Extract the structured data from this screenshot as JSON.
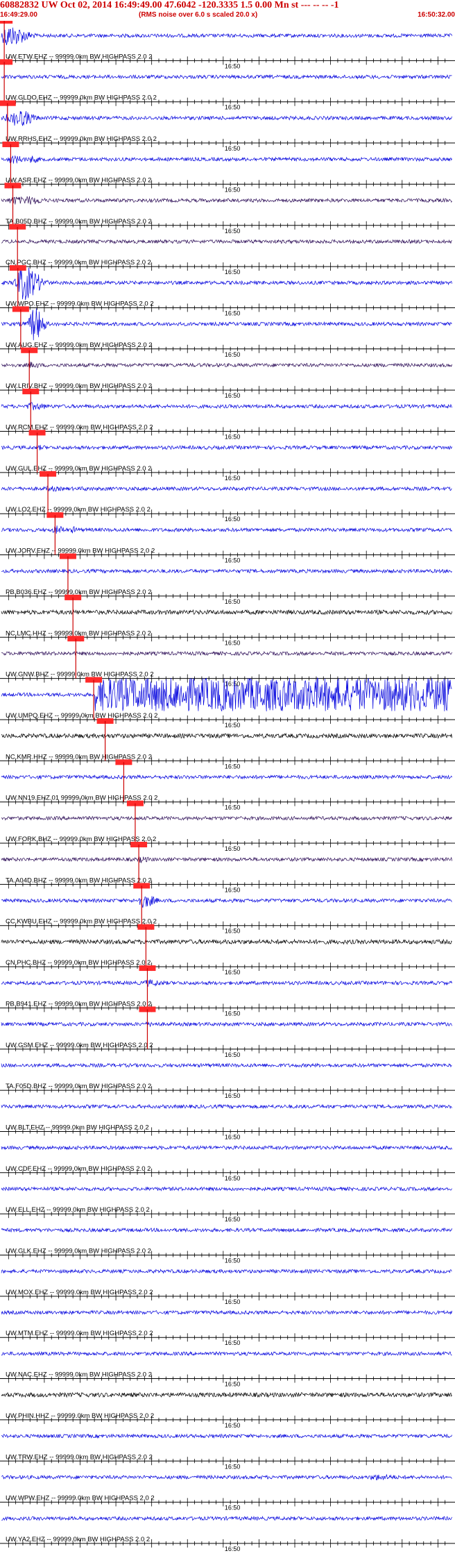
{
  "header": {
    "title": "60882832 UW Oct 02, 2014 16:49:49.00   47.6042 -120.3335  1.5 0.00 Mn st --- -- --  -1",
    "start_time": "16:49:29.00",
    "note": "(RMS noise over 6.0 s scaled 20.0 x)",
    "end_time": "16:50:32.00"
  },
  "colors": {
    "accent": "#cc0000",
    "trace_blue": "#0000dd",
    "trace_black": "#000000",
    "trace_purple": "#2a0a55",
    "pick_box": "#ff2a2a"
  },
  "chart_data": {
    "type": "line",
    "title": "60882832 UW Oct 02, 2014 16:49:49.00   47.6042 -120.3335  1.5 0.00 Mn st --- -- --  -1",
    "x_range": [
      "16:49:29.00",
      "16:50:32.00"
    ],
    "tick_label": "16:50",
    "grid": false,
    "traces": [
      {
        "label": "UW.ETW.EHZ -- 99999.0km BW  HIGHPASS  2.0  2",
        "color": "blue",
        "pick": 0.4,
        "events": [
          [
            1.0,
            3.0,
            6
          ],
          [
            0.72,
            0.3,
            8
          ],
          [
            1.12,
            0.4,
            7
          ]
        ]
      },
      {
        "label": "UW.GLDO.EHZ -- 99999.0km BW  HIGHPASS  2.0  2",
        "color": "blue",
        "pick": 0.4,
        "events": []
      },
      {
        "label": "UW.RRHS.EHZ -- 99999.0km BW  HIGHPASS  2.0  2",
        "color": "blue",
        "pick": 0.85,
        "events": [
          [
            1.0,
            2.0,
            2.5
          ],
          [
            2.25,
            2.5,
            5
          ],
          [
            3.3,
            2.0,
            3
          ]
        ]
      },
      {
        "label": "UW.ASR.EHZ -- 99999.0km BW  HIGHPASS  2.0  2",
        "color": "blue",
        "pick": 1.3,
        "events": [
          [
            1.5,
            2.2,
            2.5
          ],
          [
            4.2,
            1.5,
            2.2
          ]
        ]
      },
      {
        "label": "TA.B05D.BHZ -- 99999.0km BW  HIGHPASS  2.0  2",
        "color": "purple",
        "pick": 1.6,
        "events": [
          [
            1.7,
            2.0,
            2.5
          ],
          [
            3.7,
            2.8,
            2.5
          ]
        ]
      },
      {
        "label": "CN.PGC.BHZ -- 99999.0km BW  HIGHPASS  2.0  2",
        "color": "purple",
        "pick": 2.25,
        "events": []
      },
      {
        "label": "UW.WPO.EHZ -- 99999.0km BW  HIGHPASS  2.0  2",
        "color": "blue",
        "pick": 2.3,
        "events": [
          [
            2.5,
            2.5,
            1.8
          ],
          [
            3.0,
            2.5,
            10
          ]
        ]
      },
      {
        "label": "UW.AUG.EHZ -- 99999.0km BW  HIGHPASS  2.0  2",
        "color": "blue",
        "pick": 2.7,
        "events": [
          [
            2.8,
            1.5,
            1.5
          ],
          [
            4.5,
            1.5,
            10
          ]
        ]
      },
      {
        "label": "UW.LRIV.BHZ -- 99999.0km BW  HIGHPASS  2.0  2",
        "color": "purple",
        "pick": 3.9,
        "events": [
          [
            4.1,
            1.8,
            2
          ]
        ]
      },
      {
        "label": "UW.RCM.EHZ -- 99999.0km BW  HIGHPASS  2.0  2",
        "color": "blue",
        "pick": 4.1,
        "events": [
          [
            4.3,
            2.8,
            2.2
          ]
        ]
      },
      {
        "label": "UW.GUL.EHZ -- 99999.0km BW  HIGHPASS  2.0  2",
        "color": "blue",
        "pick": 5.0,
        "events": [
          [
            5.3,
            1.4,
            1.5
          ]
        ]
      },
      {
        "label": "UW.LO2.EHZ -- 99999.0km BW  HIGHPASS  2.0  2",
        "color": "blue",
        "pick": 6.5,
        "events": [
          [
            6.7,
            2.6,
            1.6
          ],
          [
            11.5,
            2.0,
            1.3
          ]
        ]
      },
      {
        "label": "UW.JORV.EHZ -- 99999.0km BW  HIGHPASS  2.0  2",
        "color": "blue",
        "pick": 7.5,
        "events": [
          [
            7.7,
            1.6,
            2.5
          ],
          [
            10.0,
            1.0,
            2.0
          ]
        ]
      },
      {
        "label": "PB.B036.EHZ -- 99999.0km BW  HIGHPASS  2.0  2",
        "color": "blue",
        "pick": 9.3,
        "events": []
      },
      {
        "label": "NC.LMC.HHZ -- 99999.0km BW  HIGHPASS  2.0  2",
        "color": "black",
        "pick": 10.0,
        "events": []
      },
      {
        "label": "UW.GNW.BHZ -- 99999.0km BW  HIGHPASS  2.0  2",
        "color": "purple",
        "pick": 10.4,
        "events": [
          [
            10.6,
            1.0,
            0.8
          ]
        ]
      },
      {
        "label": "UW.UMPQ.EHZ -- 99999.0km BW  HIGHPASS  2.0  2",
        "color": "blue",
        "pick": 12.9,
        "events": [
          [
            13.1,
            1.0,
            99
          ]
        ]
      },
      {
        "label": "NC.KMR.HHZ -- 99999.0km BW  HIGHPASS  2.0  2",
        "color": "black",
        "pick": 14.5,
        "events": []
      },
      {
        "label": "UW.NN19.EHZ.01 99999.0km BW  HIGHPASS  2.0  2",
        "color": "blue",
        "pick": 17.1,
        "events": []
      },
      {
        "label": "UW.FORK.BHZ -- 99999.0km BW  HIGHPASS  2.0  2",
        "color": "purple",
        "pick": 18.7,
        "events": []
      },
      {
        "label": "TA.A04D.BHZ -- 99999.0km BW  HIGHPASS  2.0  2",
        "color": "purple",
        "pick": 19.2,
        "events": [
          [
            19.5,
            1.5,
            2.0
          ]
        ]
      },
      {
        "label": "CC.KWBU.EHZ -- 99999.0km BW  HIGHPASS  2.0  2",
        "color": "blue",
        "pick": 19.6,
        "events": [
          [
            19.8,
            2.0,
            4.0
          ]
        ]
      },
      {
        "label": "CN.PHC.BHZ -- 99999.0km BW  HIGHPASS  2.0  2",
        "color": "black",
        "pick": 20.2,
        "events": []
      },
      {
        "label": "PB.B941.EHZ -- 99999.0km BW  HIGHPASS  2.0  2",
        "color": "blue",
        "pick": 20.4,
        "events": [
          [
            20.6,
            2.8,
            2.0
          ]
        ]
      },
      {
        "label": "UW.GSM.EHZ -- 99999.0km BW  HIGHPASS  2.0  2",
        "color": "blue",
        "pick": 20.4,
        "events": [
          [
            20.6,
            2.5,
            1.5
          ]
        ]
      },
      {
        "label": "TA.F05D.BHZ -- 99999.0km BW  HIGHPASS  2.0  2",
        "color": "blue",
        "pick": null,
        "events": []
      },
      {
        "label": "UW.BLT.EHZ -- 99999.0km BW  HIGHPASS  2.0  2",
        "color": "blue",
        "pick": null,
        "events": []
      },
      {
        "label": "UW.CDF.EHZ -- 99999.0km BW  HIGHPASS  2.0  2",
        "color": "blue",
        "pick": null,
        "events": []
      },
      {
        "label": "UW.ELL.EHZ -- 99999.0km BW  HIGHPASS  2.0  2",
        "color": "blue",
        "pick": null,
        "events": []
      },
      {
        "label": "UW.GLK.EHZ -- 99999.0km BW  HIGHPASS  2.0  2",
        "color": "blue",
        "pick": null,
        "events": []
      },
      {
        "label": "UW.MOX.EHZ -- 99999.0km BW  HIGHPASS  2.0  2",
        "color": "blue",
        "pick": null,
        "events": []
      },
      {
        "label": "UW.MTM.EHZ -- 99999.0km BW  HIGHPASS  2.0  2",
        "color": "blue",
        "pick": null,
        "events": []
      },
      {
        "label": "UW.NAC.EHZ -- 99999.0km BW  HIGHPASS  2.0  2",
        "color": "blue",
        "pick": null,
        "events": []
      },
      {
        "label": "UW.PHIN.HHZ -- 99999.0km BW  HIGHPASS  2.0  2",
        "color": "black",
        "pick": null,
        "events": []
      },
      {
        "label": "UW.TRW.EHZ -- 99999.0km BW  HIGHPASS  2.0  2",
        "color": "blue",
        "pick": null,
        "events": []
      },
      {
        "label": "UW.WPW.EHZ -- 99999.0km BW  HIGHPASS  2.0  2",
        "color": "blue",
        "pick": null,
        "events": [
          [
            52.5,
            4.0,
            1.8
          ]
        ]
      },
      {
        "label": "UW.YA2.EHZ -- 99999.0km BW  HIGHPASS  2.0  2",
        "color": "blue",
        "pick": null,
        "events": []
      }
    ]
  }
}
